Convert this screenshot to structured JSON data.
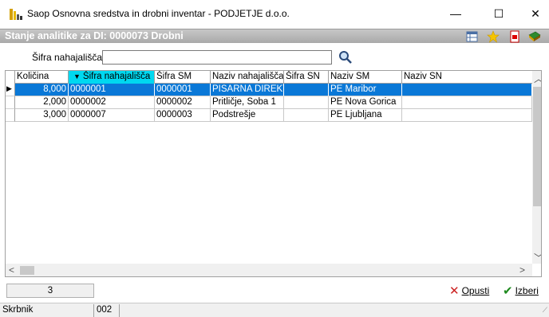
{
  "window": {
    "title": "Saop Osnovna sredstva in drobni inventar - PODJETJE d.o.o.",
    "minimize_glyph": "—",
    "maximize_glyph": "☐",
    "close_glyph": "✕"
  },
  "form": {
    "title": "Stanje analitike za DI: 0000073 Drobni",
    "header_icons": [
      "grid-settings-icon",
      "star-icon",
      "pdf-export-icon",
      "book-icon"
    ]
  },
  "search": {
    "label": "Šifra nahajališča",
    "value": "",
    "placeholder": ""
  },
  "grid": {
    "columns": [
      "Količina",
      "Šifra nahajališča",
      "Šifra SM",
      "Naziv nahajališča",
      "Šifra SN",
      "Naziv SM",
      "Naziv SN"
    ],
    "sorted_column": "Šifra nahajališča",
    "sort_glyph": "▼",
    "rows": [
      {
        "kolicina": "8,000",
        "sifra_nahajalisca": "0000001",
        "sifra_sm": "0000001",
        "naziv_nahajalisca": "PISARNA DIREKTOR",
        "sifra_sn": "",
        "naziv_sm": "PE Maribor",
        "naziv_sn": ""
      },
      {
        "kolicina": "2,000",
        "sifra_nahajalisca": "0000002",
        "sifra_sm": "0000002",
        "naziv_nahajalisca": "Pritličje, Soba 1",
        "sifra_sn": "",
        "naziv_sm": "PE Nova Gorica",
        "naziv_sn": ""
      },
      {
        "kolicina": "3,000",
        "sifra_nahajalisca": "0000007",
        "sifra_sm": "0000003",
        "naziv_nahajalisca": "Podstrešje",
        "sifra_sn": "",
        "naziv_sm": "PE Ljubljana",
        "naziv_sn": ""
      }
    ],
    "selected_row": 0,
    "row_indicator_glyph": "▶"
  },
  "footer": {
    "record_count": "3",
    "cancel_label": "Opusti",
    "select_label": "Izberi",
    "cancel_color": "#cc2222",
    "select_color": "#1e8a1e"
  },
  "statusbar": {
    "field_label": "Skrbnik",
    "field_value": "002"
  },
  "colors": {
    "selection": "#0a78d7",
    "sorted_header": "#00d8f0",
    "form_header": "#b0b0b0"
  }
}
